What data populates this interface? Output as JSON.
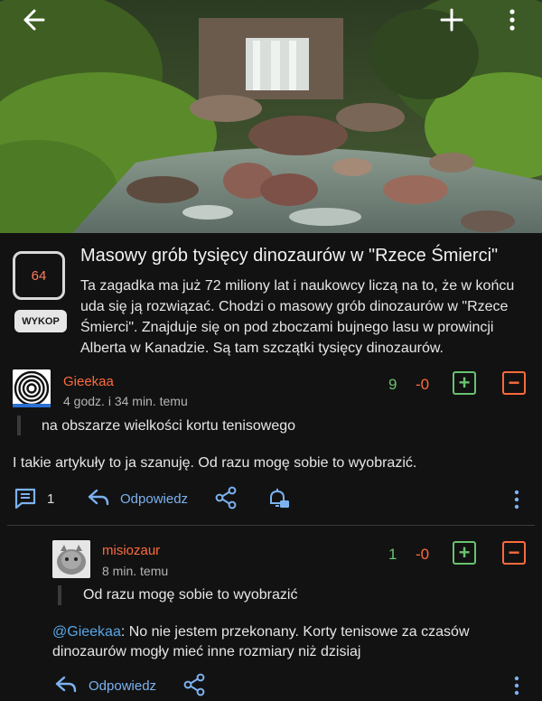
{
  "post": {
    "votes": "64",
    "wykop_label": "WYKOP",
    "title": "Masowy grób tysięcy dinozaurów w \"Rzece Śmierci\"",
    "body": "Ta zagadka ma już 72 miliony lat i naukowcy liczą na to, że w końcu uda się ją rozwiązać. Chodzi o masowy grób dinozaurów w \"Rzece Śmierci\". Znajduje się on pod zboczami bujnego lasu w prowincji Alberta w Kanadzie. Są tam szczątki tysięcy dinozaurów."
  },
  "comments": [
    {
      "username": "Gieekaa",
      "time": "4 godz. i 34 min. temu",
      "votes_plus": "9",
      "votes_minus": "-0",
      "plus_label": "+",
      "minus_label": "−",
      "quote": "na obszarze wielkości kortu tenisowego",
      "text": "I takie artykuły to ja szanuję. Od razu mogę sobie to wyobrazić.",
      "replies_count": "1",
      "reply_label": "Odpowiedz"
    },
    {
      "username": "misiozaur",
      "time": "8 min. temu",
      "votes_plus": "1",
      "votes_minus": "-0",
      "plus_label": "+",
      "minus_label": "−",
      "quote": "Od razu mogę sobie to wyobrazić",
      "mention": "@Gieekaa",
      "text": ": No nie jestem przekonany. Korty tenisowe za czasów dinozaurów mogły mieć inne rozmiary niż dzisiaj",
      "reply_label": "Odpowiedz"
    }
  ],
  "icons": {
    "back": "arrow-left-icon",
    "add": "plus-icon",
    "menu": "kebab-icon",
    "replies": "comments-icon",
    "reply": "reply-arrow-icon",
    "share": "share-icon",
    "notify": "bell-icon"
  },
  "colors": {
    "background": "#121212",
    "username": "#ff6a3d",
    "plus": "#69c26f",
    "minus": "#ff6a3d",
    "link": "#7cb2f0"
  }
}
